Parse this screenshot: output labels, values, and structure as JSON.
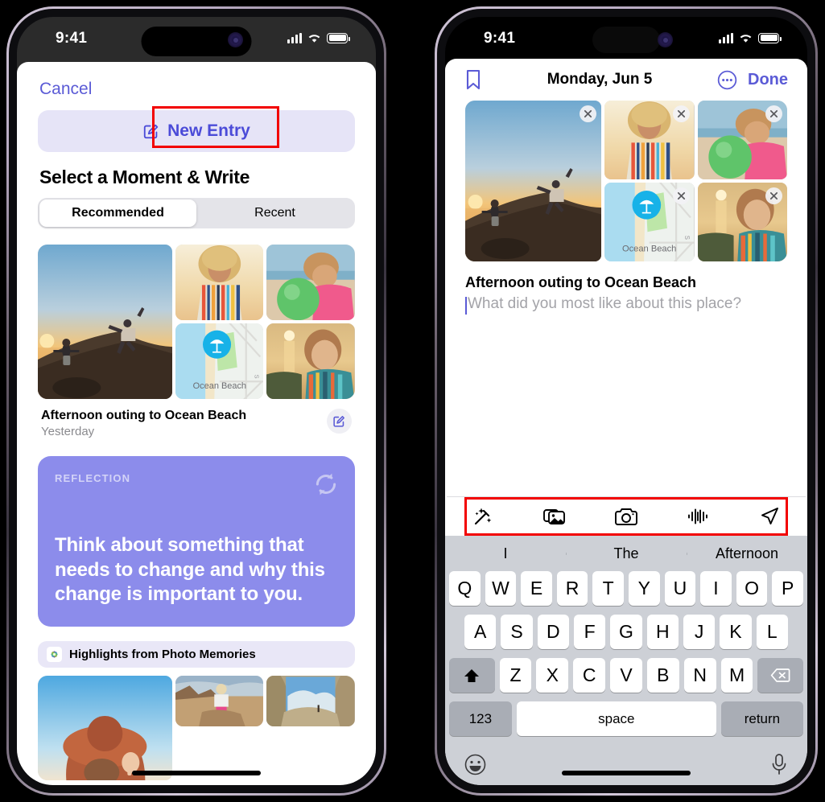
{
  "status_bar": {
    "time": "9:41",
    "signal_icon": "cellular-bars-icon",
    "wifi_icon": "wifi-icon",
    "battery_icon": "battery-icon"
  },
  "left_phone": {
    "cancel_label": "Cancel",
    "new_entry": {
      "label": "New Entry",
      "icon": "compose-square-pencil-icon",
      "highlighted": true
    },
    "section_title": "Select a Moment & Write",
    "segmented": {
      "options": [
        "Recommended",
        "Recent"
      ],
      "selected": "Recommended"
    },
    "moment": {
      "title": "Afternoon outing to Ocean Beach",
      "subtitle": "Yesterday",
      "edit_icon": "compose-square-pencil-icon",
      "map_label": "Ocean Beach",
      "photos": [
        {
          "name": "sunset-dune-two-people"
        },
        {
          "name": "curly-hair-striped-shirt-portrait"
        },
        {
          "name": "woman-with-green-ball-beach"
        },
        {
          "name": "ocean-beach-map-tile"
        },
        {
          "name": "woman-sunset-striped-top"
        }
      ]
    },
    "reflection": {
      "label": "REFLECTION",
      "text": "Think about something that needs to change and why this change is important to you.",
      "refresh_icon": "refresh-circular-arrows-icon",
      "background_color": "#8c8ceb"
    },
    "highlights": {
      "label": "Highlights from Photo Memories",
      "icon": "photos-app-icon"
    },
    "highlight_photos": [
      {
        "name": "woman-large-orange-hat"
      },
      {
        "name": "woman-sitting-desert-rocks"
      },
      {
        "name": "desert-arch-sand-dune"
      }
    ]
  },
  "right_phone": {
    "bookmark_icon": "bookmark-icon",
    "date_title": "Monday, Jun 5",
    "more_icon": "ellipsis-circle-icon",
    "done_label": "Done",
    "photos": [
      {
        "name": "sunset-dune-two-people",
        "remove_icon": "close-x-icon"
      },
      {
        "name": "curly-hair-striped-shirt-portrait",
        "remove_icon": "close-x-icon"
      },
      {
        "name": "woman-with-green-ball-beach",
        "remove_icon": "close-x-icon"
      },
      {
        "name": "ocean-beach-map-tile",
        "remove_icon": "close-x-icon"
      },
      {
        "name": "woman-sunset-striped-top",
        "remove_icon": "close-x-icon"
      }
    ],
    "map_label": "Ocean Beach",
    "entry": {
      "title": "Afternoon outing to Ocean Beach",
      "placeholder": "What did you most like about this place?",
      "value": ""
    },
    "toolbar": {
      "highlighted": true,
      "items": [
        {
          "name": "magic-wand-sparkles-icon"
        },
        {
          "name": "photos-stack-icon"
        },
        {
          "name": "camera-icon"
        },
        {
          "name": "audio-waveform-icon"
        },
        {
          "name": "location-arrow-icon"
        }
      ]
    },
    "keyboard": {
      "predictions": [
        "I",
        "The",
        "Afternoon"
      ],
      "row1": [
        "Q",
        "W",
        "E",
        "R",
        "T",
        "Y",
        "U",
        "I",
        "O",
        "P"
      ],
      "row2": [
        "A",
        "S",
        "D",
        "F",
        "G",
        "H",
        "J",
        "K",
        "L"
      ],
      "row3": [
        "Z",
        "X",
        "C",
        "V",
        "B",
        "N",
        "M"
      ],
      "shift_icon": "shift-arrow-icon",
      "backspace_icon": "backspace-delete-icon",
      "numbers_label": "123",
      "space_label": "space",
      "return_label": "return",
      "emoji_icon": "emoji-smiley-icon",
      "dictation_icon": "microphone-icon"
    }
  },
  "accent_colors": {
    "indigo": "#5b5bd6",
    "highlight_red": "#f20000",
    "reflection": "#8c8ceb"
  }
}
